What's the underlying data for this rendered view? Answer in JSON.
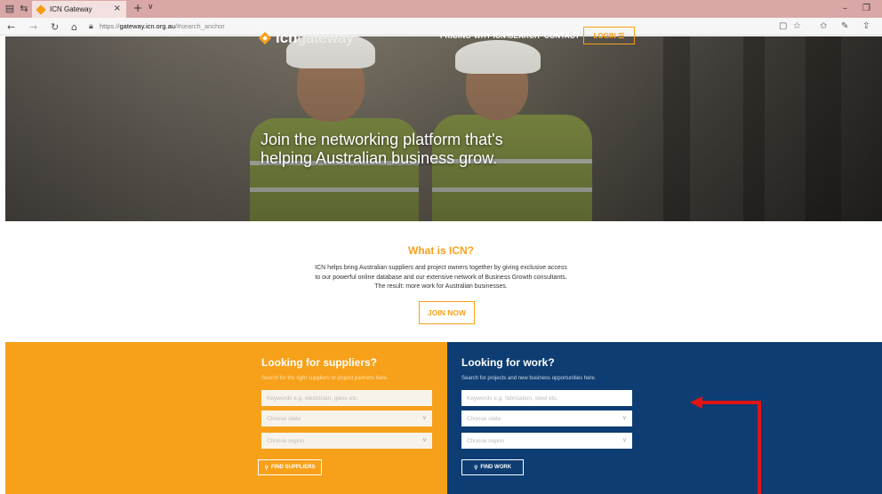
{
  "browser": {
    "tab_title": "ICN Gateway",
    "tab_close": "×",
    "new_tab": "+",
    "tab_dropdown": "∨",
    "url_scheme": "https://",
    "url_host": "gateway.icn.org.au",
    "url_path": "/#search_anchor",
    "minimize": "–",
    "restore": "❐"
  },
  "site": {
    "logo_bold": "icn",
    "logo_light": "gateway",
    "nav": [
      "PRICING",
      "WHY ICN?",
      "SEARCH",
      "CONTACT"
    ],
    "login": "LOGIN ☰",
    "headline_line1": "Join the networking platform that's",
    "headline_line2": "helping Australian business grow."
  },
  "what": {
    "title": "What is ICN?",
    "line1": "ICN helps bring Australian suppliers and project owners together by giving exclusive access",
    "line2": "to our powerful online database and our extensive network of Business Growth consultants.",
    "line3": "The result: more work for Australian businesses.",
    "join": "JOIN NOW"
  },
  "suppliers": {
    "title": "Looking for suppliers?",
    "subtitle": "Search for the right suppliers or project partners here.",
    "keywords_placeholder": "Keywords e.g. electrician, glass etc.",
    "state_placeholder": "Choose state",
    "region_placeholder": "Choose region",
    "button": "FIND SUPPLIERS"
  },
  "work": {
    "title": "Looking for work?",
    "subtitle": "Search for projects and new business opportunities here.",
    "keywords_placeholder": "Keywords e.g. fabrication, steel etc.",
    "state_placeholder": "Choose state",
    "region_placeholder": "Choose region",
    "button": "FIND WORK"
  },
  "colors": {
    "accent": "#f7a11a",
    "navy": "#0d3d73",
    "annotation": "#e31414"
  }
}
